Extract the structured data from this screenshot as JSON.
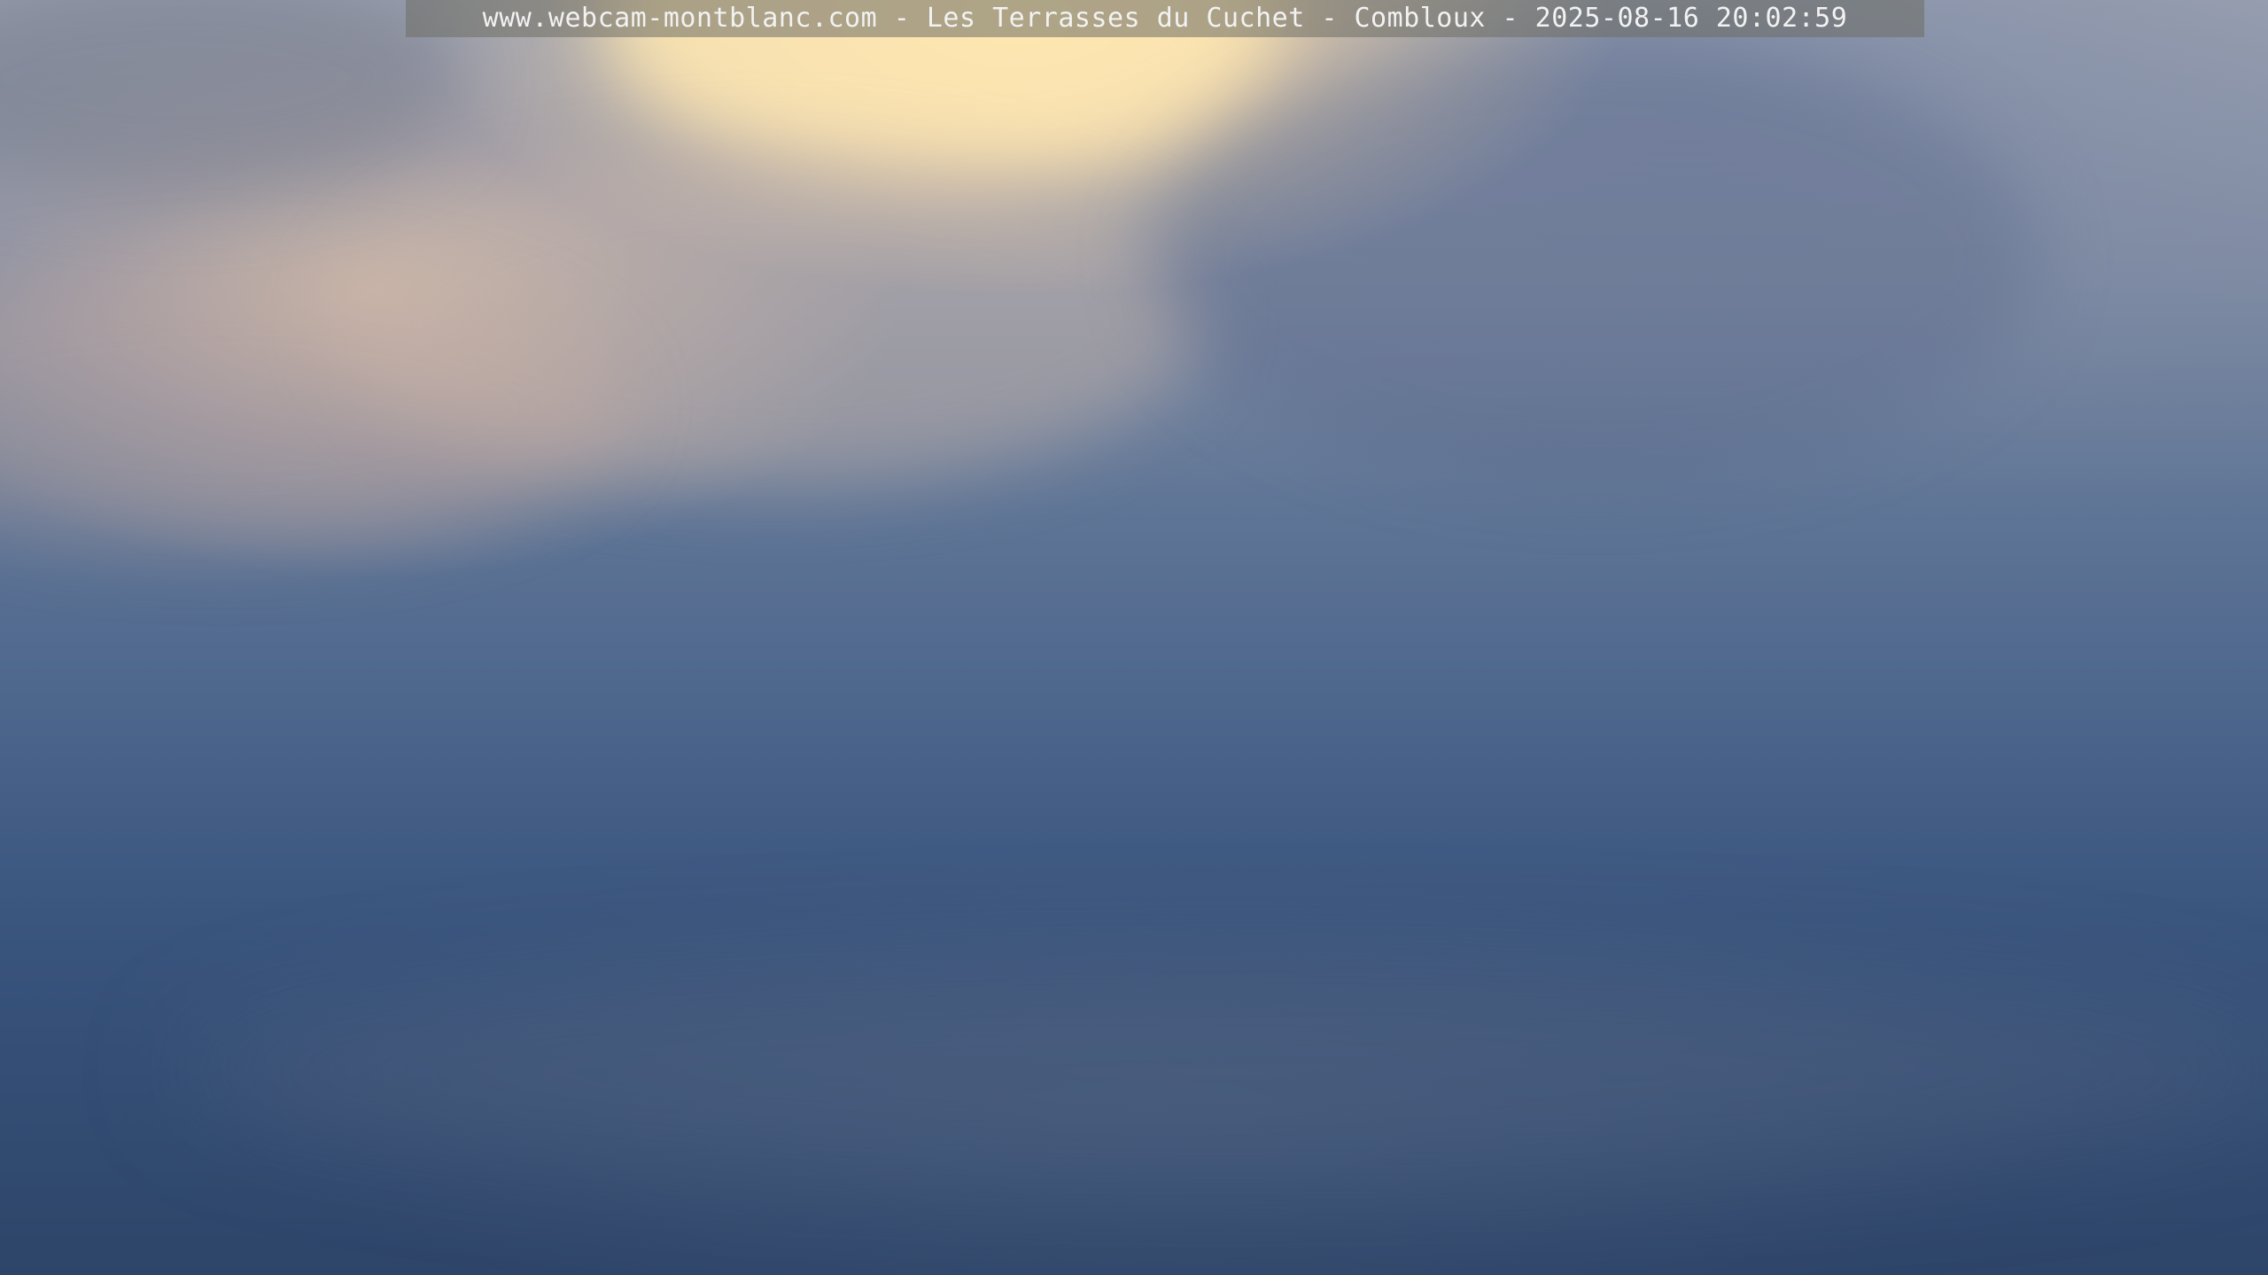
{
  "caption": {
    "site": "www.webcam-montblanc.com",
    "separator_1": " - ",
    "location": "Les Terrasses du Cuchet",
    "separator_2": " - ",
    "town": "Combloux",
    "separator_3": " - ",
    "timestamp": "2025-08-16 20:02:59"
  },
  "colors": {
    "sky_top": "#9aa0b0",
    "sky_bottom": "#2e4569",
    "sunlit_cloud": "#fce2aa",
    "caption_text": "#f2f2f2"
  }
}
